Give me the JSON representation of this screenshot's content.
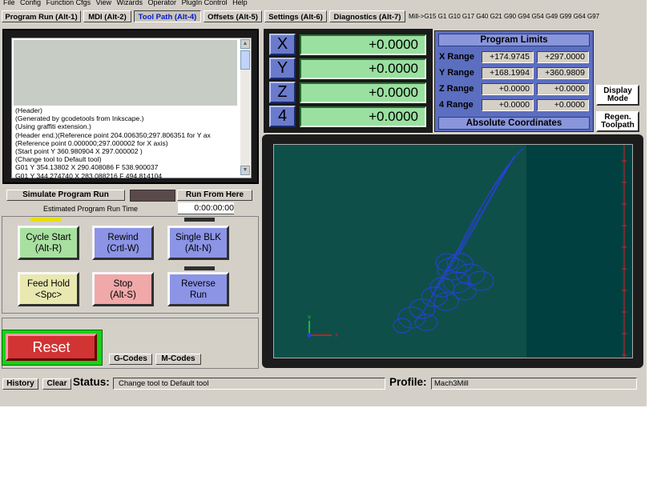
{
  "menu": [
    "File",
    "Config",
    "Function Cfgs",
    "View",
    "Wizards",
    "Operator",
    "PlugIn Control",
    "Help"
  ],
  "tabs": [
    {
      "label": "Program Run (Alt-1)"
    },
    {
      "label": "MDI (Alt-2)"
    },
    {
      "label": "Tool Path (Alt-4)"
    },
    {
      "label": "Offsets (Alt-5)"
    },
    {
      "label": "Settings (Alt-6)"
    },
    {
      "label": "Diagnostics (Alt-7)"
    }
  ],
  "modal_info": "Mill->G15  G1 G10 G17 G40 G21 G90 G94 G54 G49 G99 G64 G97",
  "gcode": {
    "lines": [
      "(Header)",
      "(Generated by gcodetools from Inkscape.)",
      "(Using graffiti extension.)",
      "(Header end.)(Reference point 204.006350;297.806351 for Y ax",
      "(Reference point 0.000000;297.000002 for X axis)",
      "(Start point  Y 360.980904 X 297.000002 )",
      "(Change tool to Default tool)",
      "G01  Y 354.13802 X 290.408086 F 538.900037",
      "G01  Y 344.274740 X 283.088216 F 494.814104"
    ]
  },
  "run_controls": {
    "simulate": "Simulate Program Run",
    "run_from_here": "Run From Here",
    "estimated_label": "Estimated Program Run Time",
    "estimated_time": "0:00:00:00"
  },
  "buttons": {
    "cycle_start": "Cycle Start\n(Alt-R)",
    "rewind": "Rewind\n(Crtl-W)",
    "single_blk": "Single BLK\n(Alt-N)",
    "feed_hold": "Feed Hold\n<Spc>",
    "stop": "Stop\n(Alt-S)",
    "reverse_run": "Reverse\nRun",
    "reset": "Reset",
    "g_codes": "G-Codes",
    "m_codes": "M-Codes"
  },
  "dro": [
    {
      "axis": "X",
      "value": "+0.0000"
    },
    {
      "axis": "Y",
      "value": "+0.0000"
    },
    {
      "axis": "Z",
      "value": "+0.0000"
    },
    {
      "axis": "4",
      "value": "+0.0000"
    }
  ],
  "limits": {
    "title": "Program Limits",
    "rows": [
      {
        "label": "X Range",
        "min": "+174.9745",
        "max": "+297.0000"
      },
      {
        "label": "Y Range",
        "min": "+168.1994",
        "max": "+360.9809"
      },
      {
        "label": "Z Range",
        "min": "+0.0000",
        "max": "+0.0000"
      },
      {
        "label": "4 Range",
        "min": "+0.0000",
        "max": "+0.0000"
      }
    ],
    "coords_button": "Absolute Coordinates"
  },
  "side_buttons": {
    "display_mode": "Display\nMode",
    "regen_toolpath": "Regen.\nToolpath"
  },
  "bottom": {
    "history": "History",
    "clear": "Clear",
    "status_label": "Status:",
    "status_text": "Change tool to Default tool",
    "profile_label": "Profile:",
    "profile_text": "Mach3Mill"
  },
  "colors": {
    "cycle_start": "#a8e0a0",
    "rewind": "#8c94e6",
    "single_blk": "#8c94e6",
    "feed_hold": "#e8e8b0",
    "stop": "#f0a8a8",
    "reverse_run": "#8c94e6",
    "reset": "#d23333",
    "toolpath": "#2a40e0",
    "viewport": "#004040"
  }
}
